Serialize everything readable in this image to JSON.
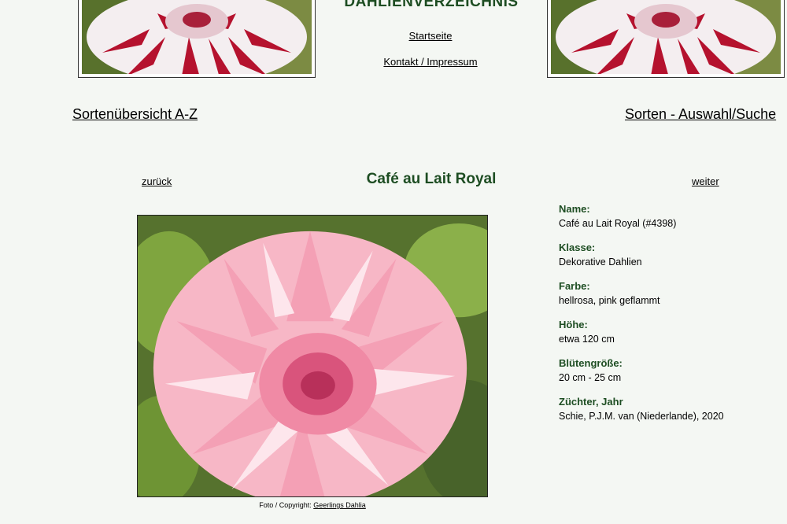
{
  "header": {
    "site_title": "DAHLIENVERZEICHNIS",
    "links": {
      "start": "Startseite",
      "contact": "Kontakt / Impressum"
    }
  },
  "nav": {
    "overview_az": "Sortenübersicht A-Z",
    "search": "Sorten - Auswahl/Suche",
    "back": "zurück",
    "next": "weiter"
  },
  "variety": {
    "title": "Café au Lait Royal",
    "photo_credit_prefix": "Foto / Copyright:",
    "photo_credit_link": "Geerlings Dahlia",
    "facts": [
      {
        "label": "Name:",
        "value": "Café au Lait Royal (#4398)"
      },
      {
        "label": "Klasse:",
        "value": "Dekorative Dahlien"
      },
      {
        "label": "Farbe:",
        "value": "hellrosa, pink geflammt"
      },
      {
        "label": "Höhe:",
        "value": "etwa 120 cm"
      },
      {
        "label": "Blütengröße:",
        "value": "20 cm - 25 cm"
      },
      {
        "label": "Züchter, Jahr",
        "value": "Schie, P.J.M. van (Niederlande), 2020"
      }
    ]
  },
  "colors": {
    "title_green": "#1d4d22",
    "background": "#f4f7f3",
    "header_flower_red": "#b5122e",
    "main_flower_pink": "#f4a0b5"
  }
}
